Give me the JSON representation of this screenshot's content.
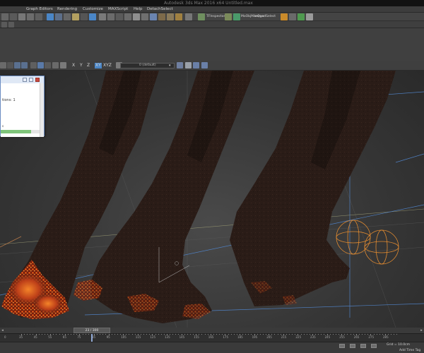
{
  "window": {
    "title": "Autodesk 3ds Max 2016 x64    Untitled.max"
  },
  "menubar": {
    "items": [
      "Graph Editors",
      "Rendering",
      "Customize",
      "MAXScript",
      "Help",
      "DetachSelect"
    ]
  },
  "toolbar": {
    "tfinspector_label": "TFInspector",
    "mergeobj_label": "MoObjManager",
    "quadselect_label": "InQuadSelect"
  },
  "axisbar": {
    "x_label": "X",
    "y_label": "Y",
    "z_label": "Z",
    "xy_label": "XY",
    "xyz_label": "XYZ",
    "layer_label": "0 (default)"
  },
  "dialog": {
    "text": "tions: 1",
    "small_text": "s",
    "progress_fraction": 0.78
  },
  "timeslider": {
    "frame_label": "23 / 300"
  },
  "trackbar": {
    "ticks": [
      "35",
      "45",
      "55",
      "65",
      "75",
      "85",
      "95",
      "105",
      "115",
      "125",
      "135",
      "145",
      "155",
      "165",
      "175",
      "185",
      "195",
      "205",
      "215",
      "225",
      "235",
      "245",
      "255",
      "265",
      "275",
      "285"
    ],
    "first_label": "0"
  },
  "statusbar": {
    "grid": "Grid = 10.0cm",
    "add_time_tag": "Add Time Tag"
  },
  "colors": {
    "accent": "#4a86c7",
    "fire_orange": "#e8661a",
    "gizmo_orange": "#e08a30",
    "smoke": "#2b1e19"
  }
}
